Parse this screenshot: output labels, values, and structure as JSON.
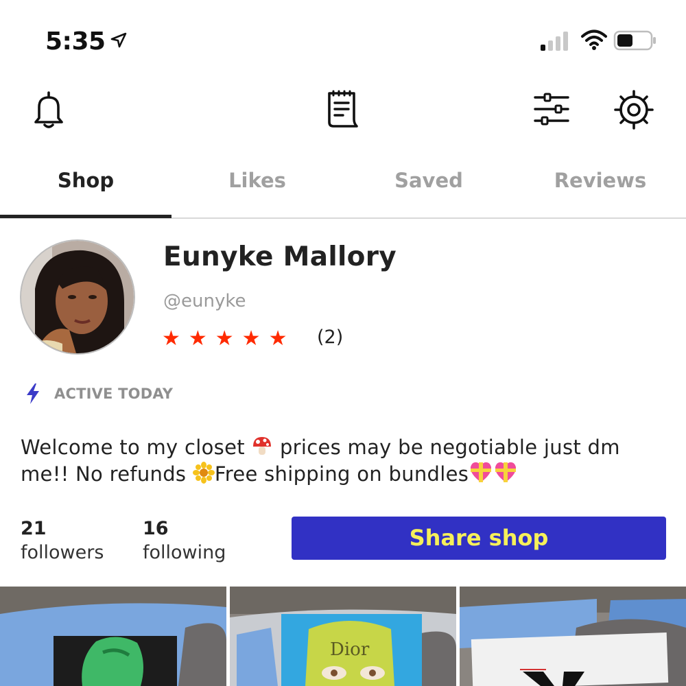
{
  "status_bar": {
    "time": "5:35"
  },
  "header": {
    "icons": [
      "bell-icon",
      "receipt-icon",
      "filter-sliders-icon",
      "gear-icon"
    ]
  },
  "tabs": [
    {
      "label": "Shop",
      "active": true
    },
    {
      "label": "Likes",
      "active": false
    },
    {
      "label": "Saved",
      "active": false
    },
    {
      "label": "Reviews",
      "active": false
    }
  ],
  "profile": {
    "name": "Eunyke Mallory",
    "handle": "@eunyke",
    "stars": "★★★★★",
    "rating": 5,
    "rating_count": "(2)",
    "active_status": "ACTIVE TODAY",
    "bio_part1": "Welcome to my closet ",
    "bio_part2": " prices may be negotiable just dm me!! No refunds ",
    "bio_part3": "Free shipping on bundles"
  },
  "stats": {
    "followers_count": "21",
    "followers_label": "followers",
    "following_count": "16",
    "following_label": "following"
  },
  "share_button": {
    "label": "Share shop"
  },
  "listing_thumbnails": [
    {
      "description_icon": "painting-thumbnail",
      "text": ""
    },
    {
      "description_icon": "painting-thumbnail",
      "text": "Dior"
    },
    {
      "description_icon": "painting-thumbnail",
      "text": ""
    }
  ],
  "colors": {
    "accent_button": "#3131c4",
    "accent_button_text": "#f6f05a",
    "stars": "#ff2a00",
    "bolt": "#3b3bc8",
    "muted_text": "#9a9a9a"
  }
}
